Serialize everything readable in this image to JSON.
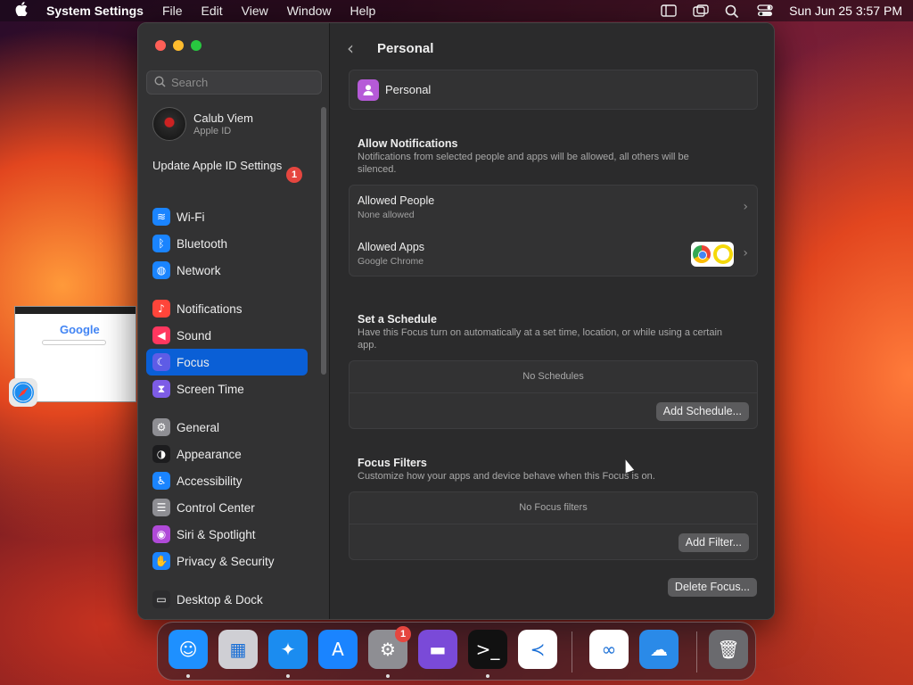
{
  "menubar": {
    "app_name": "System Settings",
    "menus": [
      "File",
      "Edit",
      "View",
      "Window",
      "Help"
    ],
    "datetime": "Sun Jun 25  3:57 PM"
  },
  "sidebar": {
    "search_placeholder": "Search",
    "account": {
      "name": "Calub Viem",
      "subtitle": "Apple ID"
    },
    "update": {
      "label": "Update Apple ID Settings",
      "badge": "1"
    },
    "groups": [
      [
        {
          "label": "Wi-Fi",
          "icon": "wifi-icon",
          "color": "#1a84ff",
          "glyph": "≋"
        },
        {
          "label": "Bluetooth",
          "icon": "bluetooth-icon",
          "color": "#1a84ff",
          "glyph": "ᛒ"
        },
        {
          "label": "Network",
          "icon": "globe-icon",
          "color": "#1a84ff",
          "glyph": "◍"
        }
      ],
      [
        {
          "label": "Notifications",
          "icon": "bell-icon",
          "color": "#ff453a",
          "glyph": "♪"
        },
        {
          "label": "Sound",
          "icon": "speaker-icon",
          "color": "#ff375f",
          "glyph": "◀"
        },
        {
          "label": "Focus",
          "icon": "moon-icon",
          "color": "#5e5ce6",
          "glyph": "☾"
        },
        {
          "label": "Screen Time",
          "icon": "hourglass-icon",
          "color": "#7d5ce6",
          "glyph": "⧗"
        }
      ],
      [
        {
          "label": "General",
          "icon": "gear-icon",
          "color": "#8e8e93",
          "glyph": "⚙"
        },
        {
          "label": "Appearance",
          "icon": "appearance-icon",
          "color": "#1c1c1e",
          "glyph": "◑"
        },
        {
          "label": "Accessibility",
          "icon": "accessibility-icon",
          "color": "#1a84ff",
          "glyph": "♿"
        },
        {
          "label": "Control Center",
          "icon": "control-center-icon",
          "color": "#8e8e93",
          "glyph": "☰"
        },
        {
          "label": "Siri & Spotlight",
          "icon": "siri-icon",
          "color": "#b04ad8",
          "glyph": "◉"
        },
        {
          "label": "Privacy & Security",
          "icon": "hand-icon",
          "color": "#1a84ff",
          "glyph": "✋"
        }
      ],
      [
        {
          "label": "Desktop & Dock",
          "icon": "desktop-dock-icon",
          "color": "#2c2c2e",
          "glyph": "▭"
        }
      ]
    ],
    "active": "Focus"
  },
  "main": {
    "title": "Personal",
    "focus_name": "Personal",
    "allow_notifications": {
      "title": "Allow Notifications",
      "desc": "Notifications from selected people and apps will be allowed, all others will be silenced.",
      "people": {
        "title": "Allowed People",
        "value": "None allowed"
      },
      "apps": {
        "title": "Allowed Apps",
        "value": "Google Chrome"
      }
    },
    "schedule": {
      "title": "Set a Schedule",
      "desc": "Have this Focus turn on automatically at a set time, location, or while using a certain app.",
      "empty": "No Schedules",
      "button": "Add Schedule..."
    },
    "filters": {
      "title": "Focus Filters",
      "desc": "Customize how your apps and device behave when this Focus is on.",
      "empty": "No Focus filters",
      "button": "Add Filter..."
    },
    "help": "?",
    "delete_button": "Delete Focus..."
  },
  "desktop": {
    "thumbnail_logo": "Google"
  },
  "dock": {
    "apps": [
      {
        "name": "finder-icon",
        "color": "#1e90ff",
        "glyph": "☺",
        "dot": true
      },
      {
        "name": "launchpad-icon",
        "color": "#cfcfd4",
        "glyph": "▦",
        "dot": false
      },
      {
        "name": "safari-icon",
        "color": "#1b8cf0",
        "glyph": "✦",
        "dot": true
      },
      {
        "name": "app-store-icon",
        "color": "#1a84ff",
        "glyph": "A",
        "dot": false
      },
      {
        "name": "system-settings-icon",
        "color": "#8e8e93",
        "glyph": "⚙",
        "dot": true,
        "badge": "1"
      },
      {
        "name": "podcasts-icon",
        "color": "#7a4ad8",
        "glyph": "▬",
        "dot": false
      },
      {
        "name": "terminal-icon",
        "color": "#111111",
        "glyph": ">_",
        "dot": true
      },
      {
        "name": "vscode-icon",
        "color": "#ffffff",
        "glyph": "≺",
        "dot": false
      },
      {
        "name": "visual-studio-icon",
        "color": "#ffffff",
        "glyph": "∞",
        "dot": false
      },
      {
        "name": "weather-icon",
        "color": "#2a8ae8",
        "glyph": "☁",
        "dot": false
      },
      {
        "name": "trash-icon",
        "color": "#6a6a6e",
        "glyph": "🗑",
        "dot": false
      }
    ]
  }
}
